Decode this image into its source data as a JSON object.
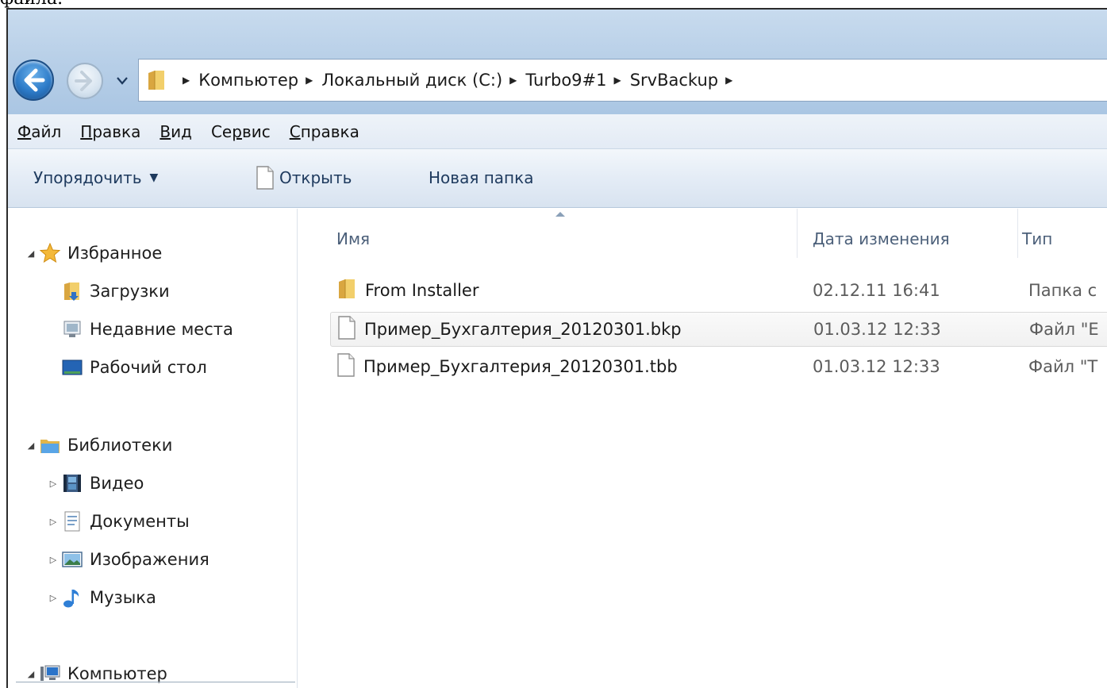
{
  "page_fragment": "файла.",
  "address_bar": {
    "breadcrumbs": [
      "Компьютер",
      "Локальный диск (C:)",
      "Turbo9#1",
      "SrvBackup"
    ]
  },
  "menu": {
    "items": [
      {
        "first": "Ф",
        "rest": "айл"
      },
      {
        "first": "П",
        "rest": "равка"
      },
      {
        "first": "В",
        "rest": "ид"
      },
      {
        "first": "Се",
        "ul": "р",
        "rest": "вис"
      },
      {
        "first": "С",
        "rest": "правка"
      }
    ]
  },
  "toolbar": {
    "organize_label": "Упорядочить",
    "open_label": "Открыть",
    "new_folder_label": "Новая папка"
  },
  "nav_pane": {
    "favorites": {
      "label": "Избранное",
      "items": [
        "Загрузки",
        "Недавние места",
        "Рабочий стол"
      ]
    },
    "libraries": {
      "label": "Библиотеки",
      "items": [
        "Видео",
        "Документы",
        "Изображения",
        "Музыка"
      ]
    },
    "computer": {
      "label": "Компьютер"
    }
  },
  "file_list": {
    "columns": {
      "name": "Имя",
      "date": "Дата изменения",
      "type": "Тип"
    },
    "rows": [
      {
        "name": "From Installer",
        "date": "02.12.11 16:41",
        "type": "Папка с",
        "icon": "folder-icon"
      },
      {
        "name": "Пример_Бухгалтерия_20120301.bkp",
        "date": "01.03.12 12:33",
        "type": "Файл \"Е",
        "icon": "file-icon"
      },
      {
        "name": "Пример_Бухгалтерия_20120301.tbb",
        "date": "01.03.12 12:33",
        "type": "Файл \"T",
        "icon": "file-icon"
      }
    ]
  },
  "colors": {
    "titlebar": "#b9d0e8",
    "toolbar_text": "#1e3a5e",
    "header_text": "#4c607a",
    "secondary_text": "#5c5c5c"
  }
}
